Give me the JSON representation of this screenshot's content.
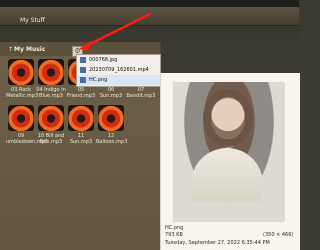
{
  "window": {
    "title": "My Stuff"
  },
  "music": {
    "title": "My Music"
  },
  "menu": {
    "items": [
      "000768.jpg",
      "20230709_162601.mp4",
      "HC.png"
    ]
  },
  "tracks": [
    "03 Rock Metallic.mp3",
    "04 Indigo in Blue.mp3",
    "05 Friend.mp3",
    "06 Sun.mp3",
    "07 Bandit.mp3",
    "09 umbledown.mp3",
    "10 Bill and Ben.mp3",
    "11 Sun.mp3",
    "12 Balloon.mp3"
  ],
  "preview": {
    "file_name": "HC.png",
    "file_size": "793 KB",
    "dimensions": "(350 × 466)",
    "date": "Tuesday, September 27, 2022 6:35:44 PM"
  },
  "colors": {
    "arrow": "#ff1a12"
  }
}
